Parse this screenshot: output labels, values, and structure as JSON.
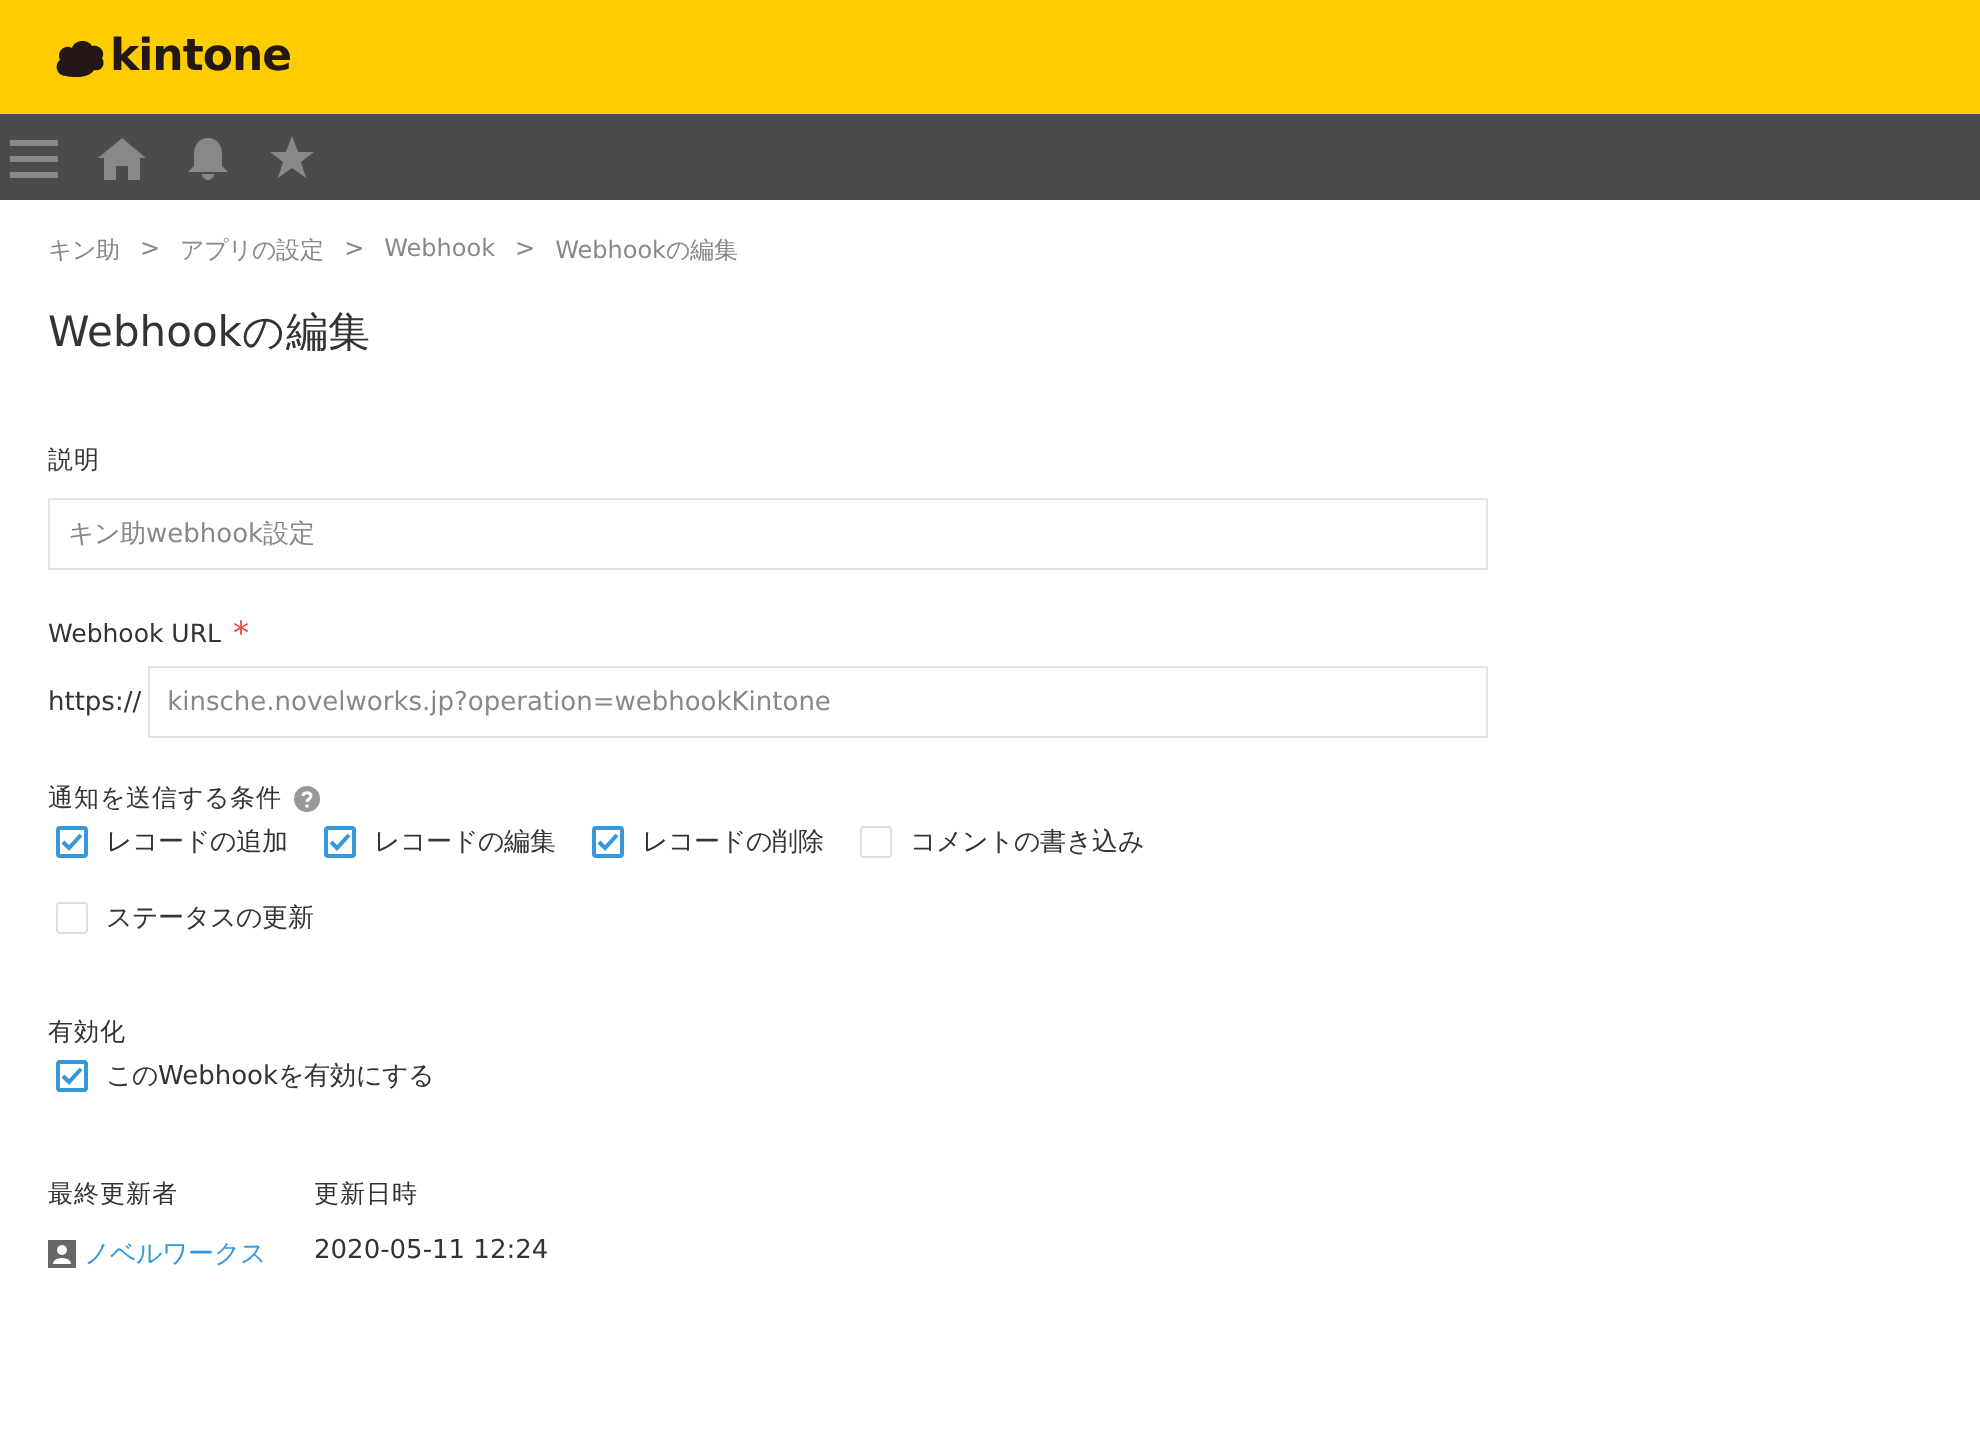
{
  "header": {
    "logo": "kintone"
  },
  "breadcrumb": [
    {
      "label": "キン助"
    },
    {
      "label": "アプリの設定"
    },
    {
      "label": "Webhook"
    },
    {
      "label": "Webhookの編集"
    }
  ],
  "breadcrumb_separator": ">",
  "title": "Webhookの編集",
  "description": {
    "label": "説明",
    "value": "キン助webhook設定"
  },
  "url": {
    "label": "Webhook URL",
    "required": true,
    "required_mark": "*",
    "prefix": "https://",
    "value": "kinsche.novelworks.jp?operation=webhookKintone"
  },
  "conditions": {
    "label": "通知を送信する条件",
    "items": [
      {
        "label": "レコードの追加",
        "checked": true
      },
      {
        "label": "レコードの編集",
        "checked": true
      },
      {
        "label": "レコードの削除",
        "checked": true
      },
      {
        "label": "コメントの書き込み",
        "checked": false
      },
      {
        "label": "ステータスの更新",
        "checked": false
      }
    ]
  },
  "activation": {
    "label": "有効化",
    "option": {
      "label": "このWebhookを有効にする",
      "checked": true
    }
  },
  "meta": {
    "updater_label": "最終更新者",
    "updated_label": "更新日時",
    "updater": "ノベルワークス",
    "updated": "2020-05-11 12:24"
  }
}
